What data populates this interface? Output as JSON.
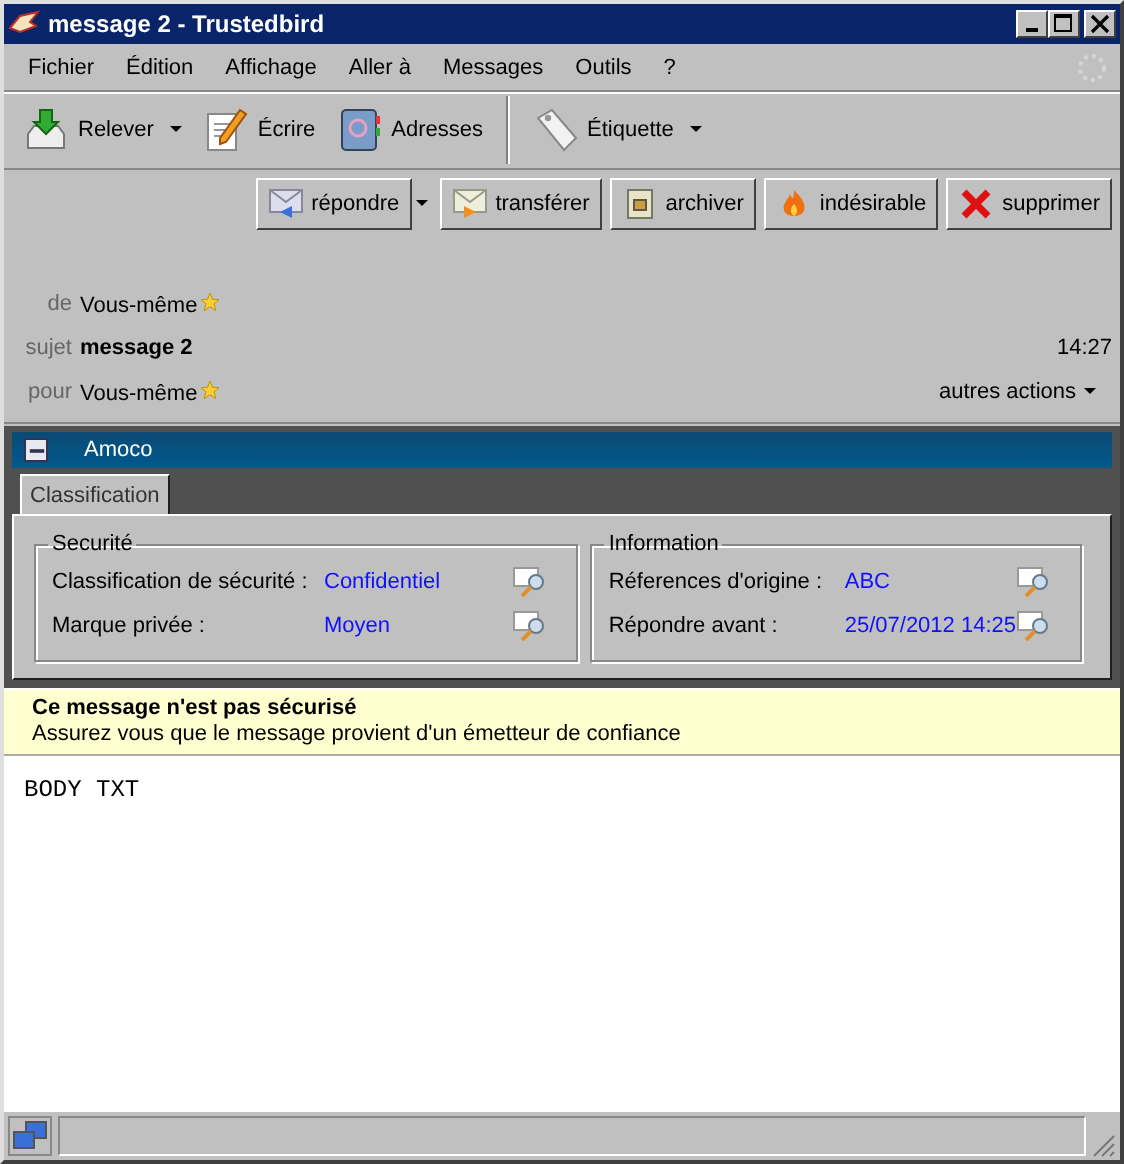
{
  "window": {
    "title": "message 2 - Trustedbird"
  },
  "menu": [
    "Fichier",
    "Édition",
    "Affichage",
    "Aller à",
    "Messages",
    "Outils",
    "?"
  ],
  "toolbar": [
    {
      "kind": "get",
      "label": "Relever",
      "dropdown": true
    },
    {
      "kind": "write",
      "label": "Écrire",
      "dropdown": false
    },
    {
      "kind": "book",
      "label": "Adresses",
      "dropdown": false
    },
    {
      "kind": "tag",
      "label": "Étiquette",
      "dropdown": true
    }
  ],
  "actions": [
    {
      "kind": "reply",
      "label": "répondre"
    },
    {
      "kind": "menu"
    },
    {
      "kind": "forward",
      "label": "transférer"
    },
    {
      "kind": "archive",
      "label": "archiver"
    },
    {
      "kind": "junk",
      "label": "indésirable"
    },
    {
      "kind": "delete",
      "label": "supprimer"
    }
  ],
  "header": [
    {
      "label": "de",
      "value": "Vous-même",
      "starred": true,
      "bold": false
    },
    {
      "label": "sujet",
      "value": "message 2",
      "starred": false,
      "bold": true,
      "time": "14:27"
    },
    {
      "label": "pour",
      "value": "Vous-même",
      "starred": true,
      "bold": false,
      "menu": "autres actions"
    }
  ],
  "panel": {
    "title": "Amoco",
    "tabs": [
      {
        "label": "Classification",
        "selected": true
      }
    ],
    "groups": [
      {
        "title": "Securité",
        "rows": [
          {
            "label": "Classification de sécurité :",
            "value": "Confidentiel"
          },
          {
            "label": "Marque privée :",
            "value": "Moyen"
          }
        ]
      },
      {
        "title": "Information",
        "rows": [
          {
            "label": "Réferences d'origine :",
            "value": "ABC"
          },
          {
            "label": "Répondre avant :",
            "value": "25/07/2012 14:25"
          }
        ]
      }
    ]
  },
  "notice": {
    "title": "Ce message n'est pas sécurisé",
    "text": "Assurez vous que le message provient d'un émetteur de confiance"
  },
  "body": "BODY TXT"
}
